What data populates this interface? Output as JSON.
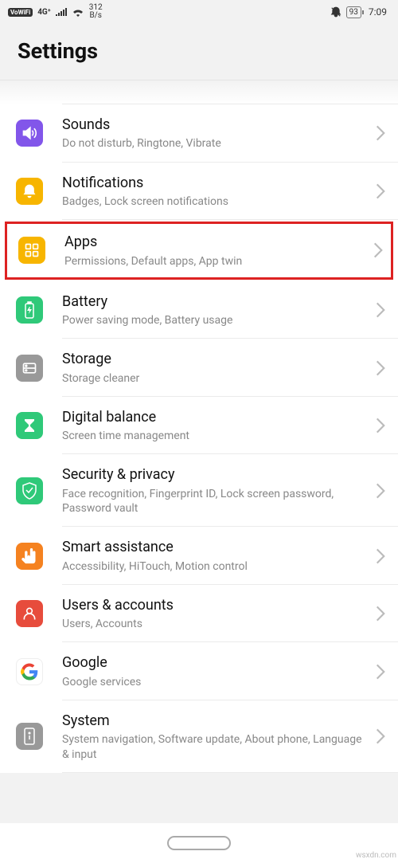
{
  "status": {
    "vowifi": "VoWiFi",
    "fourg": "4G⁺",
    "speed_val": "312",
    "speed_unit": "B/s",
    "battery": "93",
    "time": "7:09"
  },
  "header": {
    "title": "Settings"
  },
  "rows": {
    "sounds": {
      "title": "Sounds",
      "subtitle": "Do not disturb, Ringtone, Vibrate"
    },
    "notifications": {
      "title": "Notifications",
      "subtitle": "Badges, Lock screen notifications"
    },
    "apps": {
      "title": "Apps",
      "subtitle": "Permissions, Default apps, App twin"
    },
    "battery": {
      "title": "Battery",
      "subtitle": "Power saving mode, Battery usage"
    },
    "storage": {
      "title": "Storage",
      "subtitle": "Storage cleaner"
    },
    "digital_balance": {
      "title": "Digital balance",
      "subtitle": "Screen time management"
    },
    "security": {
      "title": "Security & privacy",
      "subtitle": "Face recognition, Fingerprint ID, Lock screen password, Password vault"
    },
    "smart": {
      "title": "Smart assistance",
      "subtitle": "Accessibility, HiTouch, Motion control"
    },
    "users": {
      "title": "Users & accounts",
      "subtitle": "Users, Accounts"
    },
    "google": {
      "title": "Google",
      "subtitle": "Google services"
    },
    "system": {
      "title": "System",
      "subtitle": "System navigation, Software update, About phone, Language & input"
    }
  },
  "watermark": "wsxdn.com"
}
